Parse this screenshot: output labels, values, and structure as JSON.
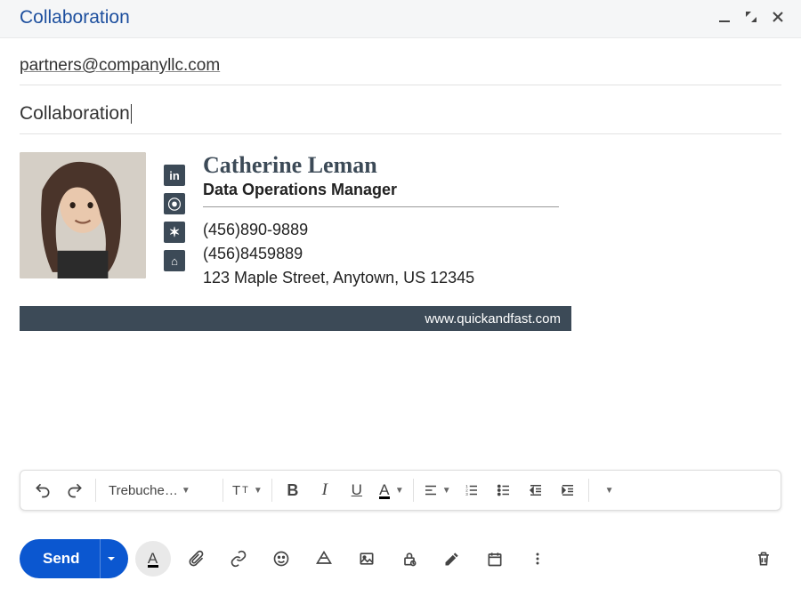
{
  "header": {
    "title": "Collaboration"
  },
  "fields": {
    "recipient": "partners@companyllc.com",
    "subject": "Collaboration"
  },
  "signature": {
    "name": "Catherine Leman",
    "role": "Data Operations Manager",
    "phone1": "(456)890-9889",
    "phone2": "(456)8459889",
    "address": "123 Maple Street, Anytown, US 12345",
    "website": "www.quickandfast.com",
    "social": [
      "in",
      "m",
      "y",
      "z"
    ]
  },
  "toolbar": {
    "font_label": "Trebuche…"
  },
  "actions": {
    "send_label": "Send"
  }
}
